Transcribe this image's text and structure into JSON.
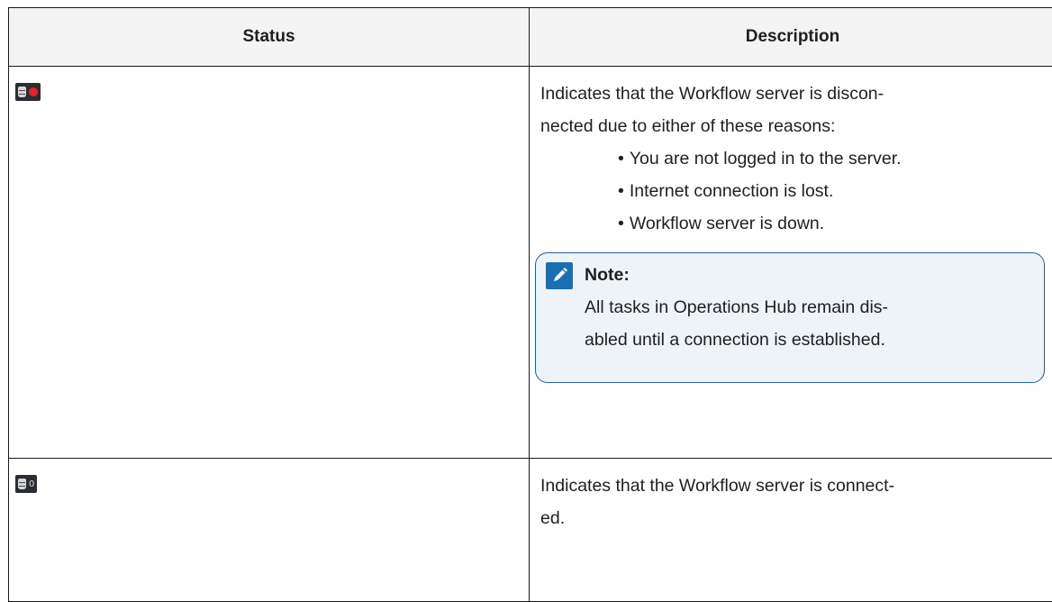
{
  "header": {
    "status_label": "Status",
    "description_label": "Description"
  },
  "rows": [
    {
      "status_icon": "workflow-server-disconnected-icon",
      "description_lines": [
        "Indicates that the Workflow server is discon-",
        "nected due to either of these reasons:"
      ],
      "reasons": [
        "You are not logged in to the server.",
        "Internet connection is lost.",
        "Workflow server is down."
      ],
      "note": {
        "icon": "pencil-note-icon",
        "title": "Note:",
        "lines": [
          "All tasks in Operations Hub remain dis-",
          "abled until a connection is established."
        ]
      }
    },
    {
      "status_icon": "workflow-server-connected-icon",
      "status_count": "0",
      "description_lines": [
        "Indicates that the Workflow server is connect-",
        "ed."
      ]
    }
  ],
  "colors": {
    "disconnected_dot": "#e8202a",
    "icon_background": "#2a2d31",
    "note_border": "#1c5f9a",
    "note_icon_bg": "#1a6fb0"
  }
}
